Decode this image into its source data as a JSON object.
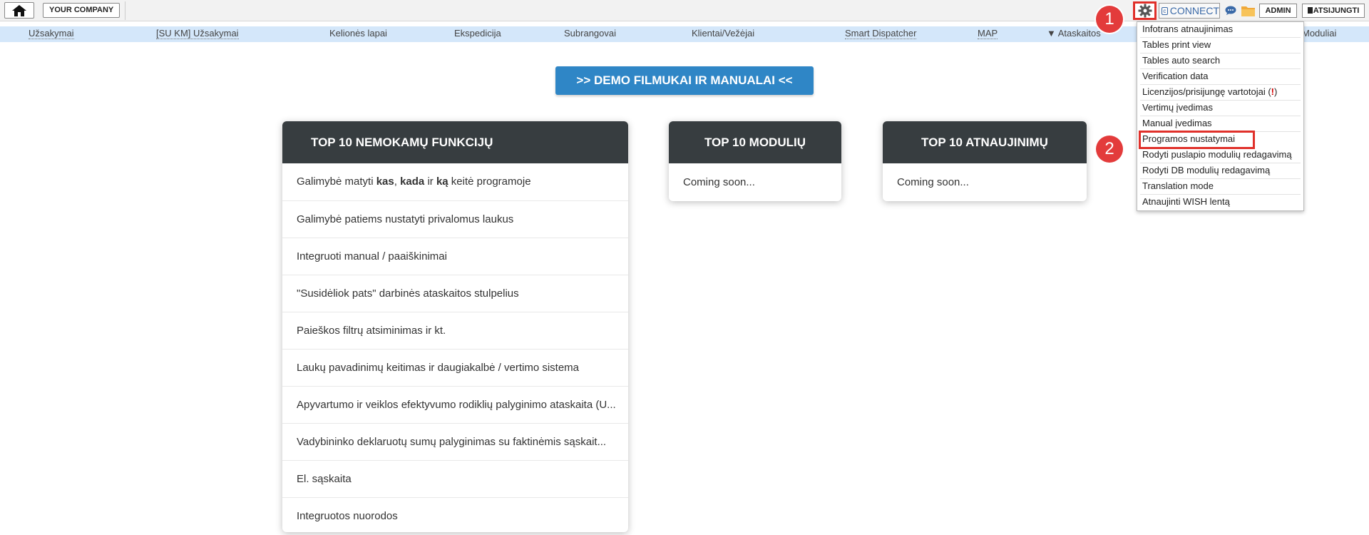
{
  "topbar": {
    "company_label": "YOUR COMPANY",
    "connect_label": "CONNECT",
    "admin_label": "ADMIN",
    "logout_label": "ATSIJUNGTI"
  },
  "nav": {
    "items": [
      {
        "label": "Užsakymai"
      },
      {
        "label": "[SU KM] Užsakymai"
      },
      {
        "label": "Kelionės lapai"
      },
      {
        "label": "Ekspedicija"
      },
      {
        "label": "Subrangovai"
      },
      {
        "label": "Klientai/Vežėjai"
      },
      {
        "label": "Smart Dispatcher"
      },
      {
        "label": "MAP"
      },
      {
        "label": "▼ Ataskaitos"
      },
      {
        "label": "Moduliai"
      }
    ]
  },
  "demo_button": ">> DEMO FILMUKAI IR MANUALAI <<",
  "cards": {
    "functions": {
      "title": "TOP 10 NEMOKAMŲ FUNKCIJŲ",
      "rows": [
        {
          "pre": "Galimybė matyti ",
          "b1": "kas",
          "sep1": ", ",
          "b2": "kada",
          "mid": " ir ",
          "b3": "ką",
          "post": " keitė programoje"
        },
        {
          "text": "Galimybė patiems nustatyti privalomus laukus"
        },
        {
          "text": "Integruoti manual / paaiškinimai"
        },
        {
          "text": "\"Susidėliok pats\" darbinės ataskaitos stulpelius"
        },
        {
          "text": "Paieškos filtrų atsiminimas ir kt."
        },
        {
          "text": "Laukų pavadinimų keitimas ir daugiakalbė / vertimo sistema"
        },
        {
          "text": "Apyvartumo ir veiklos efektyvumo rodiklių palyginimo ataskaita (U..."
        },
        {
          "text": "Vadybininko deklaruotų sumų palyginimas su faktinėmis sąskait..."
        },
        {
          "text": "El. sąskaita"
        },
        {
          "text": "Integruotos nuorodos"
        }
      ]
    },
    "modules": {
      "title": "TOP 10 MODULIŲ",
      "body": "Coming soon..."
    },
    "updates": {
      "title": "TOP 10 ATNAUJINIMŲ",
      "body": "Coming soon..."
    }
  },
  "settings_menu": {
    "items": [
      {
        "label": "Infotrans atnaujinimas"
      },
      {
        "label": "Tables print view"
      },
      {
        "label": "Tables auto search"
      },
      {
        "label": "Verification data"
      },
      {
        "label": "Licenzijos/prisijungę vartotojai (",
        "warn": "!",
        "suffix": ")"
      },
      {
        "label": "Vertimų įvedimas"
      },
      {
        "label": "Manual įvedimas"
      },
      {
        "label": "Programos nustatymai"
      },
      {
        "label": "Rodyti puslapio modulių redagavimą"
      },
      {
        "label": "Rodyti DB modulių redagavimą"
      },
      {
        "label": "Translation mode"
      },
      {
        "label": "Atnaujinti WISH lentą"
      }
    ]
  },
  "badges": {
    "step1": "1",
    "step2": "2"
  },
  "colors": {
    "accent_red": "#e33b3b",
    "demo_blue": "#2f86c6",
    "card_header": "#373d40",
    "nav_bg": "#d4e7fa"
  }
}
